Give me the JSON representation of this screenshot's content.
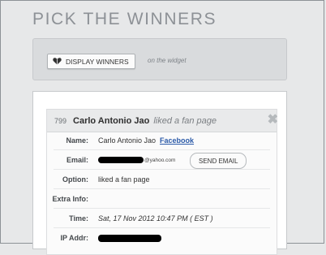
{
  "page": {
    "title": "PICK THE WINNERS"
  },
  "toolbar": {
    "display_label": "DISPLAY WINNERS",
    "display_icon": "heart-icon",
    "hint": "on the widget"
  },
  "entry": {
    "number": "799",
    "name": "Carlo Antonio Jao",
    "action": "liked a fan page",
    "close_icon": "close-icon",
    "rows": {
      "name": {
        "label": "Name:",
        "value": "Carlo Antonio Jao",
        "link": "Facebook"
      },
      "email": {
        "label": "Email:",
        "domain": "@yahoo.com",
        "button": "SEND EMAIL"
      },
      "option": {
        "label": "Option:",
        "value": "liked a fan page"
      },
      "extra": {
        "label": "Extra Info:",
        "value": ""
      },
      "time": {
        "label": "Time:",
        "value": "Sat, 17 Nov 2012 10:47 PM ( EST )"
      },
      "ip": {
        "label": "IP Addr:"
      }
    }
  },
  "colors": {
    "accent_link": "#2b5aa8",
    "title_gray": "#8d9196",
    "background": "#e7e8e9"
  }
}
